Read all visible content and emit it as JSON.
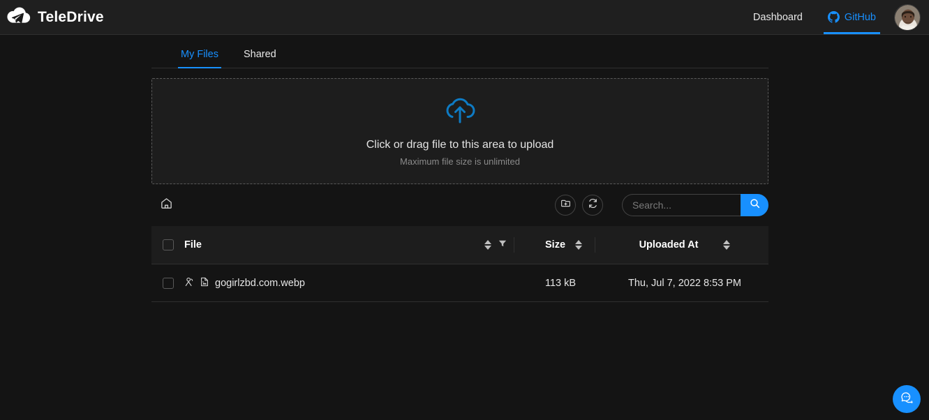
{
  "brand": {
    "name": "TeleDrive",
    "logo_icon": "telegram-cloud-logo"
  },
  "header": {
    "nav": [
      {
        "label": "Dashboard",
        "icon": null,
        "active": false
      },
      {
        "label": "GitHub",
        "icon": "github-icon",
        "active": true
      }
    ],
    "avatar_icon": "user-avatar"
  },
  "tabs": [
    {
      "label": "My Files",
      "active": true
    },
    {
      "label": "Shared",
      "active": false
    }
  ],
  "dropzone": {
    "icon": "cloud-upload-icon",
    "title": "Click or drag file to this area to upload",
    "subtitle": "Maximum file size is unlimited"
  },
  "toolbar": {
    "home_icon": "home-icon",
    "new_folder_icon": "folder-add-icon",
    "refresh_icon": "refresh-icon",
    "search_placeholder": "Search...",
    "search_value": "",
    "search_icon": "search-icon"
  },
  "table": {
    "columns": [
      {
        "label": "File",
        "sort_icon": "sort-caret-icon",
        "filter_icon": "filter-funnel-icon"
      },
      {
        "label": "Size",
        "sort_icon": "sort-caret-icon"
      },
      {
        "label": "Uploaded At",
        "sort_icon": "sort-caret-icon"
      }
    ],
    "rows": [
      {
        "shared_icon": "user-shared-icon",
        "file_icon": "image-file-icon",
        "name": "gogirlzbd.com.webp",
        "size": "113 kB",
        "uploaded_at": "Thu, Jul 7, 2022 8:53 PM"
      }
    ]
  },
  "fab": {
    "icon": "chat-bubble-icon"
  },
  "colors": {
    "accent": "#1890ff",
    "page_bg": "#141414",
    "header_bg": "#1f1f1f",
    "panel_bg": "#1d1d1d",
    "border": "#303030",
    "text": "#e6e6e6",
    "muted": "#8a8a8a"
  }
}
